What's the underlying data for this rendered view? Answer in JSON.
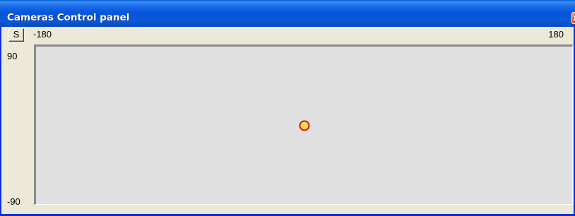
{
  "window": {
    "title": "Cameras Control panel",
    "close_label": "x"
  },
  "toolbar": {
    "s_button_label": "S"
  },
  "axis": {
    "x_min_label": "-180",
    "x_max_label": "180",
    "y_max_label": "90",
    "y_min_label": "-90",
    "x_range": [
      -180,
      180
    ],
    "y_range": [
      -90,
      90
    ]
  },
  "camera": {
    "pan": 0,
    "tilt": 0
  },
  "colors": {
    "title_bar": "#0a5ad8",
    "panel_bg": "#ece9d8",
    "plot_bg": "#e0e0e0",
    "marker_outline": "#e01010",
    "marker_fill": "#f0e050"
  },
  "icons": {
    "close": "close-icon"
  }
}
